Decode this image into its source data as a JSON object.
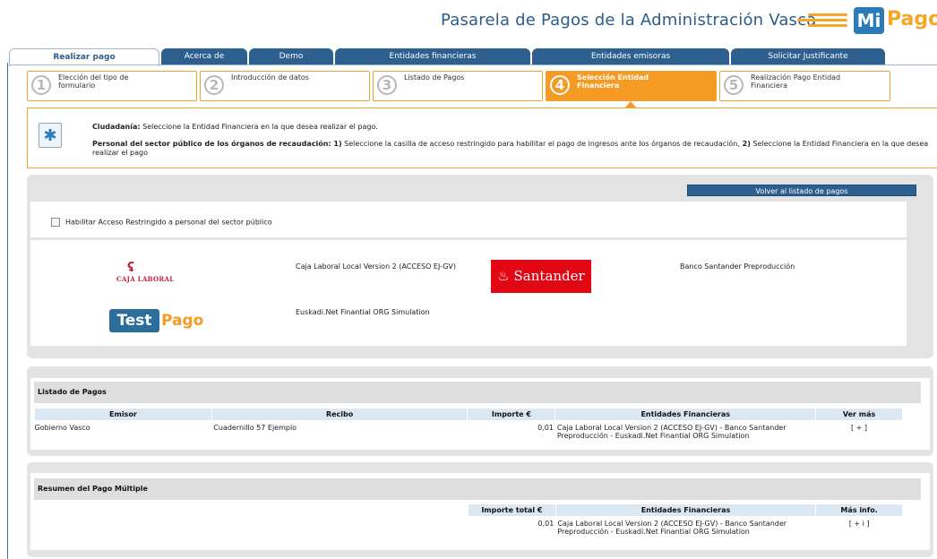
{
  "header": {
    "title": "Pasarela de Pagos de la Administración Vasca",
    "logo_mi": "Mi",
    "logo_pago": "Pago"
  },
  "tabs": [
    {
      "label": "Realizar pago",
      "active": true
    },
    {
      "label": "Acerca de"
    },
    {
      "label": "Demo"
    },
    {
      "label": "Entidades financieras"
    },
    {
      "label": "Entidades emisoras"
    },
    {
      "label": "Solicitar Justificante"
    }
  ],
  "steps": [
    {
      "num": "1",
      "label": "Elección del tipo de formulario"
    },
    {
      "num": "2",
      "label": "Introducción de datos"
    },
    {
      "num": "3",
      "label": "Listado de Pagos"
    },
    {
      "num": "4",
      "label": "Selección Entidad Financiera",
      "active": true
    },
    {
      "num": "5",
      "label": "Realización Pago Entidad Financiera"
    }
  ],
  "info": {
    "line1_bold": "Ciudadanía:",
    "line1": " Seleccione la Entidad Financiera en la que desea realizar el pago.",
    "line2_bold": "Personal del sector público de los órganos de recaudación:",
    "line2_b1": " 1)",
    "line2_a": " Seleccione la casilla de acceso restringido para habilitar el pago de ingresos ante los órganos de recaudación,",
    "line2_b2": " 2)",
    "line2_b": " Seleccione la Entidad Financiera en la que desea",
    "line3": "realizar el pago"
  },
  "entities_panel": {
    "volver_label": "Volver al listado de pagos",
    "restricted_label": "Habilitar Acceso Restringido a personal del sector público",
    "entities": [
      {
        "logo_text": "CAJA LABORAL",
        "logo_symbol": "ʢ",
        "name": "Caja Laboral Local Version 2 (ACCESO EJ-GV)"
      },
      {
        "logo_text": "Santander",
        "name": "Banco Santander Preproducción"
      },
      {
        "logo_text_a": "Test",
        "logo_text_b": "Pago",
        "name": "Euskadi.Net Finantial ORG Simulation"
      }
    ]
  },
  "listado": {
    "title": "Listado de Pagos",
    "headers": [
      "Emisor",
      "Recibo",
      "Importe €",
      "Entidades Financieras",
      "Ver más"
    ],
    "row": {
      "emisor": "Gobierno Vasco",
      "recibo": "Cuadernillo 57 Ejemplo",
      "importe": "0,01",
      "entidades": "Caja Laboral Local Version 2 (ACCESO EJ-GV) - Banco Santander Preproducción - Euskadi.Net Finantial ORG Simulation",
      "ver_mas": "[ + ]"
    }
  },
  "resumen": {
    "title": "Resumen del Pago Múltiple",
    "headers": [
      "Importe total €",
      "Entidades Financieras",
      "Más info."
    ],
    "row": {
      "importe": "0,01",
      "entidades": "Caja Laboral Local Version 2 (ACCESO EJ-GV) - Banco Santander Preproducción - Euskadi.Net Finantial ORG Simulation",
      "mas_info": "[ + i ]"
    }
  },
  "colors": {
    "tab_blue": "#2d5f8f",
    "step_orange": "#f59b23",
    "santander_red": "#e30613"
  },
  "icons": {
    "info_icon": "info-notepad-icon",
    "checkbox_icon": "checkbox-icon"
  }
}
